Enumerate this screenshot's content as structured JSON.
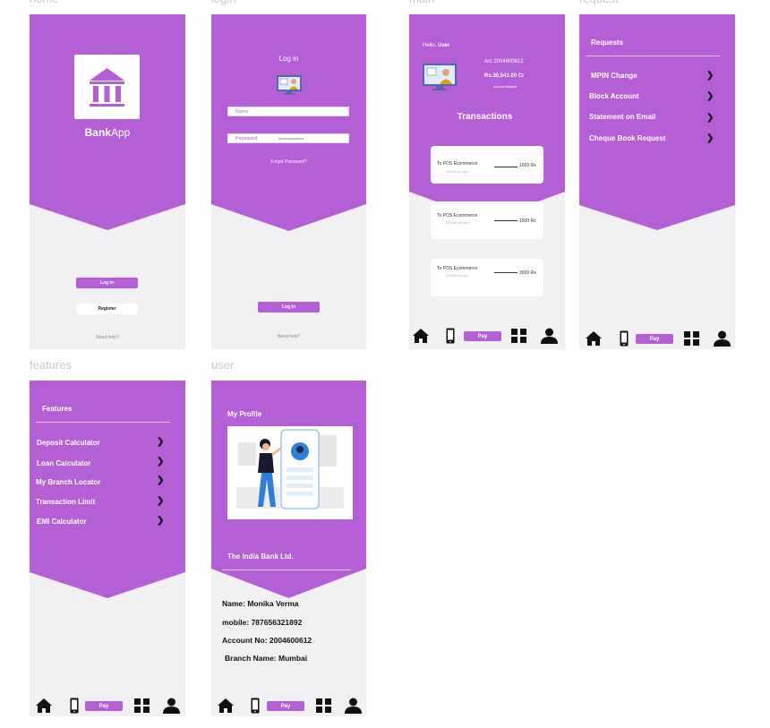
{
  "frames": {
    "home": "home",
    "login": "login",
    "main": "main",
    "request": "request",
    "features": "features",
    "user": "user"
  },
  "home": {
    "logo_bold": "Bank",
    "logo_rest": "App",
    "login_btn": "Log In",
    "register_btn": "Register",
    "help": "Need help?"
  },
  "login": {
    "title": "Log in",
    "name_placeholder": "Name",
    "password_label": "Password",
    "password_value": "••••••••••••••••••••",
    "forgot": "Forgot Password?",
    "login_btn": "Log In",
    "help": "Need help?"
  },
  "main": {
    "hello": "Hello,",
    "user": "User",
    "account": "A/c  2004600612",
    "balance": "Rs.30,541.00 Cr",
    "balance_label": "Account Balance",
    "transactions_title": "Transactions",
    "transactions": [
      {
        "desc": "To POS Ecommerce",
        "date": "20JUN at 1pm",
        "amount": "1000 Rs"
      },
      {
        "desc": "To POS Ecommerce",
        "date": "20JUN at 1pm",
        "amount": "1500 Rs"
      },
      {
        "desc": "To POS Ecommerce",
        "date": "20JUN at 1pm",
        "amount": "3000 Rs"
      }
    ]
  },
  "request": {
    "title": "Requests",
    "items": [
      "MPIN Change",
      "Block Account",
      "Statement on Email",
      "Cheque Book Request"
    ]
  },
  "features": {
    "title": "Features",
    "items": [
      "Deposit Calculator",
      "Loan Calculator",
      "My Branch Locator",
      "Transaction Limit",
      "EMI Calculator"
    ]
  },
  "user": {
    "title": "My Profile",
    "bank": "The India Bank Ltd.",
    "name": "Name: Monika Verma",
    "mobile": "mobile: 787656321892",
    "account": "Account No: 2004600612",
    "branch": "Branch Name: Mumbai"
  },
  "nav": {
    "pay": "Pay",
    "icons": [
      "home-icon",
      "phone-icon",
      "grid-icon",
      "user-icon"
    ]
  },
  "colors": {
    "accent": "#b45fd6",
    "background": "#f1f1f3"
  }
}
